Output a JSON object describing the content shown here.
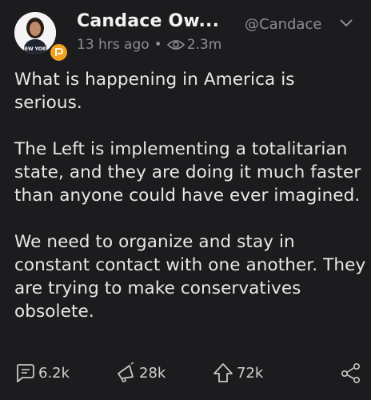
{
  "author": {
    "name": "Candace Ow...",
    "handle": "@Candace",
    "avatar_icon": "profile-photo",
    "badge_icon": "parler-badge-icon"
  },
  "meta": {
    "time": "13 hrs ago",
    "separator": "•",
    "views": "2.3m"
  },
  "post": {
    "paragraphs": [
      "What is happening in America is serious.",
      "The Left is implementing a totalitarian state, and they are doing it much faster than anyone could have ever imagined.",
      "We need to organize and stay in constant contact with one another. They are trying to make conservatives obsolete."
    ]
  },
  "actions": {
    "comments": "6.2k",
    "echoes": "28k",
    "votes": "72k"
  },
  "colors": {
    "background": "#1c1c1e",
    "text": "#e8e8e8",
    "muted": "#8e8e93",
    "badge": "#f0a321"
  }
}
